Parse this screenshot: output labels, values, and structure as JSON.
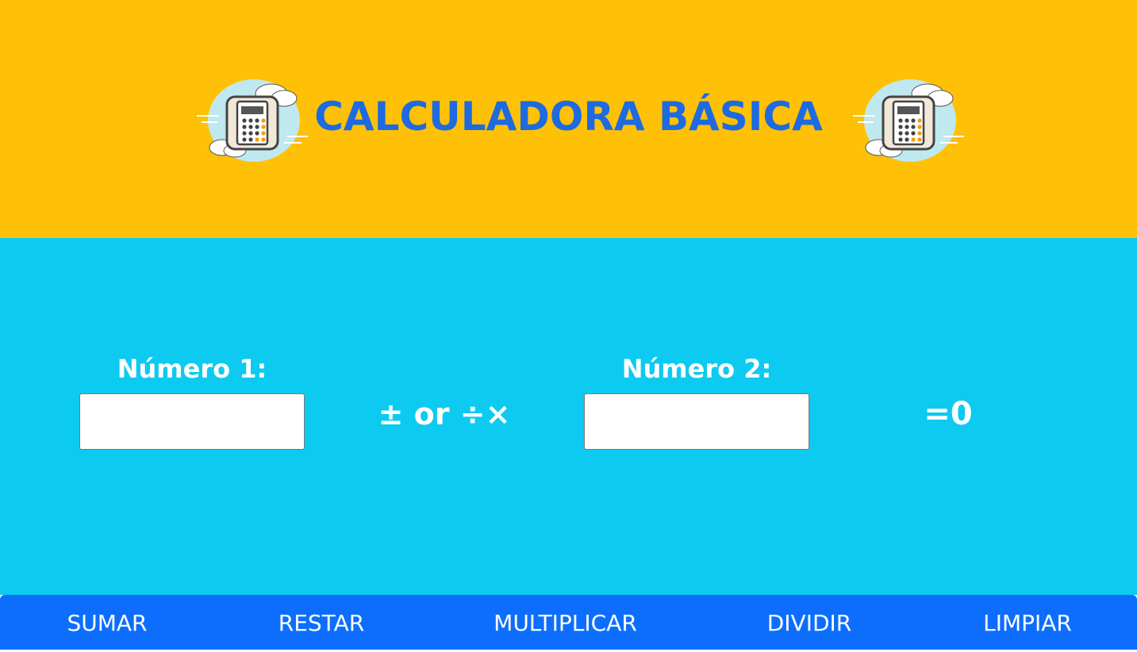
{
  "header": {
    "title": "CALCULADORA BÁSICA",
    "icon": "calculator-icon",
    "background_color": "#FFC107",
    "title_color": "#1E6AE0"
  },
  "form": {
    "number1_label": "Número 1:",
    "number1_value": "",
    "number2_label": "Número 2:",
    "number2_value": "",
    "operator_text": "± or ÷×",
    "result_text": "=0",
    "background_color": "#0DCAF0"
  },
  "footer": {
    "background_color": "#0D6EFD",
    "buttons": [
      {
        "label": "SUMAR"
      },
      {
        "label": "RESTAR"
      },
      {
        "label": "MULTIPLICAR"
      },
      {
        "label": "DIVIDIR"
      },
      {
        "label": "LIMPIAR"
      }
    ]
  }
}
